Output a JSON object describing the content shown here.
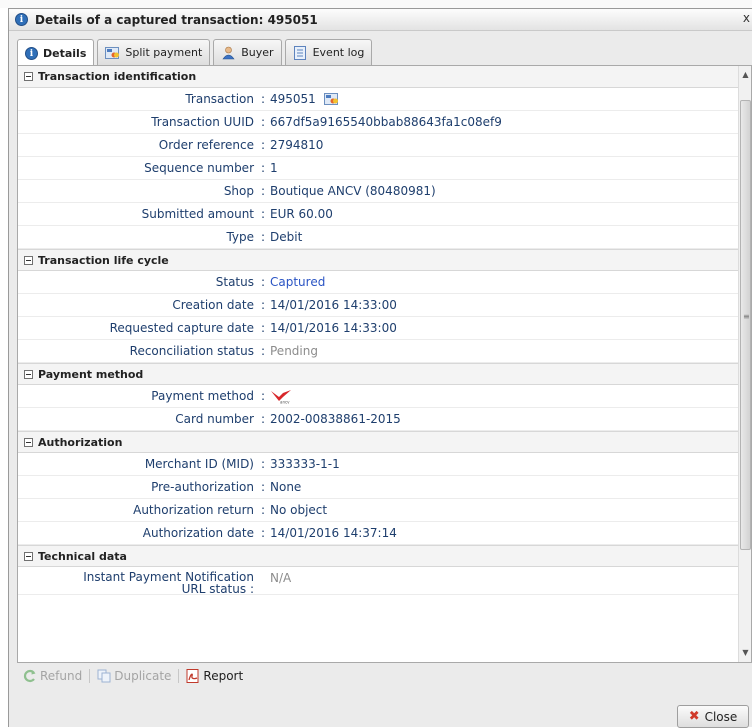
{
  "dialog": {
    "title": "Details of a captured transaction: 495051",
    "close_glyph": "x"
  },
  "tabs": [
    {
      "label": "Details",
      "icon": "info-icon",
      "active": true
    },
    {
      "label": "Split payment",
      "icon": "split-payment-icon"
    },
    {
      "label": "Buyer",
      "icon": "buyer-icon"
    },
    {
      "label": "Event log",
      "icon": "event-log-icon"
    }
  ],
  "sections": {
    "identification": {
      "title": "Transaction identification",
      "transaction": {
        "label": "Transaction",
        "value": "495051"
      },
      "uuid": {
        "label": "Transaction UUID",
        "value": "667df5a9165540bbab88643fa1c08ef9"
      },
      "order_reference": {
        "label": "Order reference",
        "value": "2794810"
      },
      "sequence_number": {
        "label": "Sequence number",
        "value": "1"
      },
      "shop": {
        "label": "Shop",
        "value": "Boutique ANCV (80480981)"
      },
      "submitted_amount": {
        "label": "Submitted amount",
        "value": "EUR 60.00"
      },
      "type": {
        "label": "Type",
        "value": "Debit"
      }
    },
    "life_cycle": {
      "title": "Transaction life cycle",
      "status": {
        "label": "Status",
        "value": "Captured"
      },
      "creation_date": {
        "label": "Creation date",
        "value": "14/01/2016 14:33:00"
      },
      "requested_capture_date": {
        "label": "Requested capture date",
        "value": "14/01/2016 14:33:00"
      },
      "reconciliation_status": {
        "label": "Reconciliation status",
        "value": "Pending"
      }
    },
    "payment_method": {
      "title": "Payment method",
      "payment_method": {
        "label": "Payment method",
        "logo_text": "ancv"
      },
      "card_number": {
        "label": "Card number",
        "value": "2002-00838861-2015"
      }
    },
    "authorization": {
      "title": "Authorization",
      "merchant_id": {
        "label": "Merchant ID (MID)",
        "value": "333333-1-1"
      },
      "pre_authorization": {
        "label": "Pre-authorization",
        "value": "None"
      },
      "authorization_return": {
        "label": "Authorization return",
        "value": "No object"
      },
      "authorization_date": {
        "label": "Authorization date",
        "value": "14/01/2016 14:37:14"
      }
    },
    "technical": {
      "title": "Technical data",
      "ipn_url_status": {
        "label_line1": "Instant Payment Notification",
        "label_line2": "URL status",
        "value": "N/A"
      }
    }
  },
  "separator": ":",
  "toolbar": {
    "refund_label": "Refund",
    "duplicate_label": "Duplicate",
    "report_label": "Report"
  },
  "footer": {
    "close_label": "Close"
  },
  "colors": {
    "label_blue": "#1e3e6d",
    "status_blue": "#2a54c4",
    "disabled_grey": "#a4a4a4",
    "ancv_red": "#d8262a"
  }
}
